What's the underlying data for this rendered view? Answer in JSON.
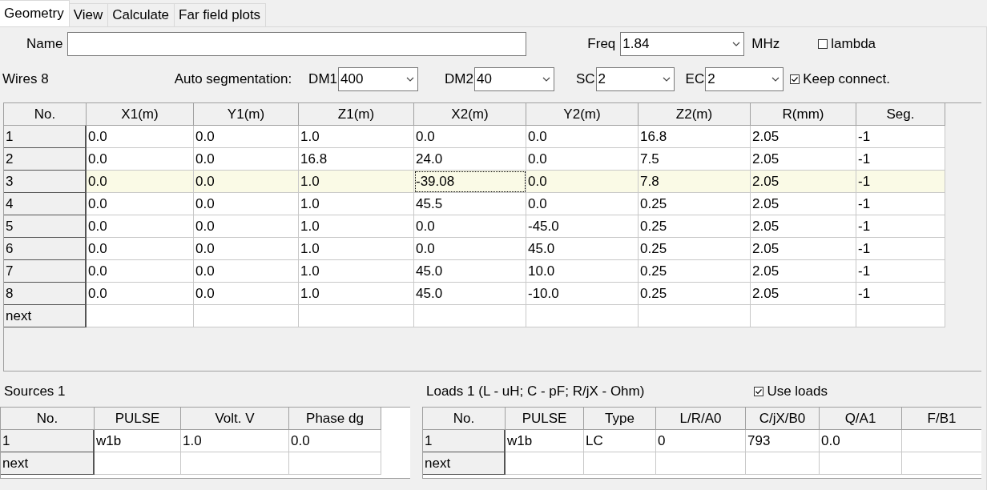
{
  "tabs": [
    {
      "label": "Geometry",
      "selected": true
    },
    {
      "label": "View",
      "selected": false
    },
    {
      "label": "Calculate",
      "selected": false
    },
    {
      "label": "Far field plots",
      "selected": false
    }
  ],
  "name_field": {
    "label": "Name"
  },
  "freq": {
    "label": "Freq",
    "value": "1.84",
    "unit": "MHz"
  },
  "lambda": {
    "label": "lambda",
    "checked": false
  },
  "wires_count": "Wires 8",
  "auto_segmentation": {
    "label": "Auto segmentation:",
    "fields": [
      {
        "label": "DM1",
        "value": "400"
      },
      {
        "label": "DM2",
        "value": "40"
      },
      {
        "label": "SC",
        "value": "2"
      },
      {
        "label": "EC",
        "value": "2"
      }
    ]
  },
  "keep_connect": {
    "label": "Keep connect.",
    "checked": true
  },
  "wires_table": {
    "columns": [
      "No.",
      "X1(m)",
      "Y1(m)",
      "Z1(m)",
      "X2(m)",
      "Y2(m)",
      "Z2(m)",
      "R(mm)",
      "Seg."
    ],
    "rows": [
      {
        "no": "1",
        "selected": false,
        "cells": [
          {
            "text": "0.0",
            "focused": false
          },
          {
            "text": "0.0",
            "focused": false
          },
          {
            "text": "1.0",
            "focused": false
          },
          {
            "text": "0.0",
            "focused": false
          },
          {
            "text": "0.0",
            "focused": false
          },
          {
            "text": "16.8",
            "focused": false
          },
          {
            "text": "2.05",
            "focused": false
          },
          {
            "text": "-1",
            "focused": false
          }
        ]
      },
      {
        "no": "2",
        "selected": false,
        "cells": [
          {
            "text": "0.0",
            "focused": false
          },
          {
            "text": "0.0",
            "focused": false
          },
          {
            "text": "16.8",
            "focused": false
          },
          {
            "text": "24.0",
            "focused": false
          },
          {
            "text": "0.0",
            "focused": false
          },
          {
            "text": "7.5",
            "focused": false
          },
          {
            "text": "2.05",
            "focused": false
          },
          {
            "text": "-1",
            "focused": false
          }
        ]
      },
      {
        "no": "3",
        "selected": true,
        "cells": [
          {
            "text": "0.0",
            "focused": false
          },
          {
            "text": "0.0",
            "focused": false
          },
          {
            "text": "1.0",
            "focused": false
          },
          {
            "text": "-39.08",
            "focused": true
          },
          {
            "text": "0.0",
            "focused": false
          },
          {
            "text": "7.8",
            "focused": false
          },
          {
            "text": "2.05",
            "focused": false
          },
          {
            "text": "-1",
            "focused": false
          }
        ]
      },
      {
        "no": "4",
        "selected": false,
        "cells": [
          {
            "text": "0.0",
            "focused": false
          },
          {
            "text": "0.0",
            "focused": false
          },
          {
            "text": "1.0",
            "focused": false
          },
          {
            "text": "45.5",
            "focused": false
          },
          {
            "text": "0.0",
            "focused": false
          },
          {
            "text": "0.25",
            "focused": false
          },
          {
            "text": "2.05",
            "focused": false
          },
          {
            "text": "-1",
            "focused": false
          }
        ]
      },
      {
        "no": "5",
        "selected": false,
        "cells": [
          {
            "text": "0.0",
            "focused": false
          },
          {
            "text": "0.0",
            "focused": false
          },
          {
            "text": "1.0",
            "focused": false
          },
          {
            "text": "0.0",
            "focused": false
          },
          {
            "text": "-45.0",
            "focused": false
          },
          {
            "text": "0.25",
            "focused": false
          },
          {
            "text": "2.05",
            "focused": false
          },
          {
            "text": "-1",
            "focused": false
          }
        ]
      },
      {
        "no": "6",
        "selected": false,
        "cells": [
          {
            "text": "0.0",
            "focused": false
          },
          {
            "text": "0.0",
            "focused": false
          },
          {
            "text": "1.0",
            "focused": false
          },
          {
            "text": "0.0",
            "focused": false
          },
          {
            "text": "45.0",
            "focused": false
          },
          {
            "text": "0.25",
            "focused": false
          },
          {
            "text": "2.05",
            "focused": false
          },
          {
            "text": "-1",
            "focused": false
          }
        ]
      },
      {
        "no": "7",
        "selected": false,
        "cells": [
          {
            "text": "0.0",
            "focused": false
          },
          {
            "text": "0.0",
            "focused": false
          },
          {
            "text": "1.0",
            "focused": false
          },
          {
            "text": "45.0",
            "focused": false
          },
          {
            "text": "10.0",
            "focused": false
          },
          {
            "text": "0.25",
            "focused": false
          },
          {
            "text": "2.05",
            "focused": false
          },
          {
            "text": "-1",
            "focused": false
          }
        ]
      },
      {
        "no": "8",
        "selected": false,
        "cells": [
          {
            "text": "0.0",
            "focused": false
          },
          {
            "text": "0.0",
            "focused": false
          },
          {
            "text": "1.0",
            "focused": false
          },
          {
            "text": "45.0",
            "focused": false
          },
          {
            "text": "-10.0",
            "focused": false
          },
          {
            "text": "0.25",
            "focused": false
          },
          {
            "text": "2.05",
            "focused": false
          },
          {
            "text": "-1",
            "focused": false
          }
        ]
      }
    ],
    "next_label": "next"
  },
  "sources": {
    "title": "Sources 1",
    "columns": [
      "No.",
      "PULSE",
      "Volt. V",
      "Phase dg"
    ],
    "rows": [
      {
        "no": "1",
        "cells": [
          "w1b",
          "1.0",
          "0.0"
        ]
      }
    ],
    "next_label": "next"
  },
  "loads": {
    "title": "Loads 1 (L - uH; C - pF; R/jX - Ohm)",
    "use_loads": {
      "label": "Use loads",
      "checked": true
    },
    "columns": [
      "No.",
      "PULSE",
      "Type",
      "L/R/A0",
      "C/jX/B0",
      "Q/A1",
      "F/B1"
    ],
    "rows": [
      {
        "no": "1",
        "cells": [
          "w1b",
          "LC",
          "0",
          "793",
          "0.0"
        ]
      }
    ],
    "next_label": "next"
  }
}
